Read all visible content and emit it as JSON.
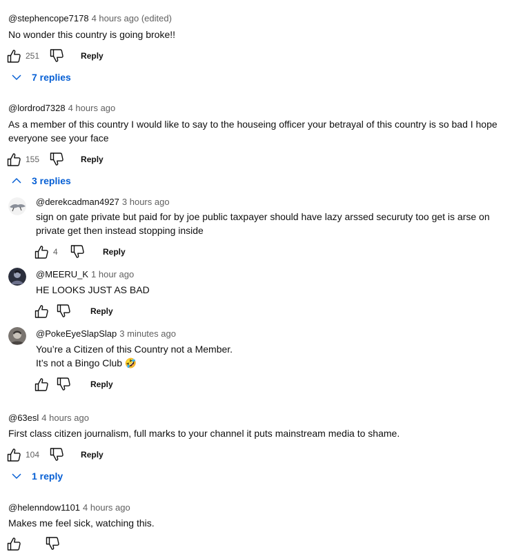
{
  "comments": [
    {
      "author": "@stephencope7178",
      "time": "4 hours ago (edited)",
      "text": "No wonder this country is going broke!!",
      "likes": "251",
      "reply_label": "Reply",
      "replies_toggle": "7 replies"
    },
    {
      "author": "@lordrod7328",
      "time": "4 hours ago",
      "text": "As a member of this country I would like to say to the houseing officer your betrayal of this country is so bad I hope everyone see your face",
      "likes": "155",
      "reply_label": "Reply",
      "replies_toggle": "3 replies",
      "replies": [
        {
          "author": "@derekcadman4927",
          "time": "3 hours ago",
          "text": "sign on gate private but paid for by joe public taxpayer should have lazy arssed securuty too get is arse on private get then instead stopping inside",
          "likes": "4",
          "reply_label": "Reply"
        },
        {
          "author": "@MEERU_K",
          "time": "1 hour ago",
          "text": "HE LOOKS JUST AS BAD",
          "reply_label": "Reply"
        },
        {
          "author": "@PokeEyeSlapSlap",
          "time": "3 minutes ago",
          "text_line1": "You’re a Citizen of this Country not a Member.",
          "text_line2": "It’s not a Bingo Club 🤣",
          "reply_label": "Reply"
        }
      ]
    },
    {
      "author": "@63esl",
      "time": "4 hours ago",
      "text": "First class citizen journalism, full marks to your channel it puts mainstream media to shame.",
      "likes": "104",
      "reply_label": "Reply",
      "replies_toggle": "1 reply"
    },
    {
      "author": "@helenndow1101",
      "time": "4 hours ago",
      "text": "Makes me feel sick, watching this."
    }
  ],
  "icons": {
    "like": "thumbs-up-icon",
    "dislike": "thumbs-down-icon",
    "expand": "chevron-down-icon",
    "collapse": "chevron-up-icon"
  },
  "colors": {
    "link": "#065fd4",
    "meta": "#606060",
    "text": "#0f0f0f"
  }
}
